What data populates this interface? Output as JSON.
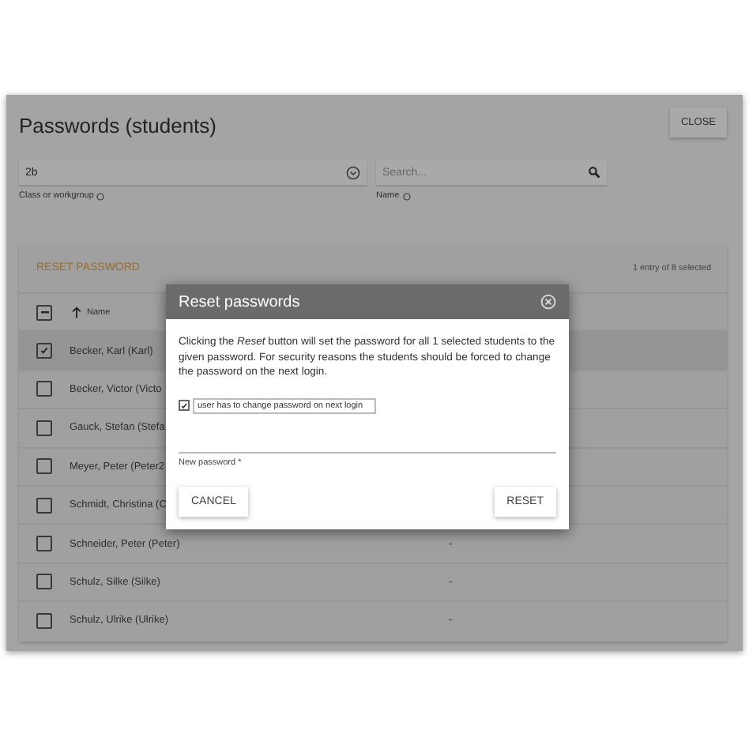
{
  "window": {
    "title": "Passwords (students)",
    "close_button": "CLOSE"
  },
  "filters": [
    {
      "kind": "select",
      "value": "2b",
      "label": "Class or workgroup"
    },
    {
      "kind": "search",
      "placeholder": "Search...",
      "label": "Name"
    }
  ],
  "table": {
    "action": "RESET PASSWORD",
    "selection_info": "1 entry of 8 selected",
    "header": {
      "indeterminate": true,
      "sort_label": "Name"
    },
    "rows": [
      {
        "name": "Becker, Karl (Karl)",
        "checked": true
      },
      {
        "name": "Becker, Victor (Victo",
        "checked": false
      },
      {
        "name": "Gauck, Stefan (Stefa",
        "checked": false
      },
      {
        "name": "Meyer, Peter (Peter2",
        "checked": false
      },
      {
        "name": "Schmidt, Christina (C",
        "checked": false
      },
      {
        "name": "Schneider, Peter (Peter)",
        "checked": false,
        "column_2": "-"
      },
      {
        "name": "Schulz, Silke (Silke)",
        "checked": false,
        "column_2": "-"
      },
      {
        "name": "Schulz, Ulrike (Ulrike)",
        "checked": false,
        "column_2": "-"
      }
    ]
  },
  "dialog": {
    "title": "Reset passwords",
    "message": "Clicking the *Reset* button will set the password for all 1 selected students to the given password. For security reasons the students should be forced to change the password on the next login.",
    "force_change": {
      "label": "user has to change password on next login",
      "checked": true
    },
    "password": {
      "label": "New password *"
    },
    "buttons": [
      {
        "kind": "cancel",
        "label": "CANCEL"
      },
      {
        "kind": "confirm",
        "label": "RESET"
      }
    ]
  }
}
